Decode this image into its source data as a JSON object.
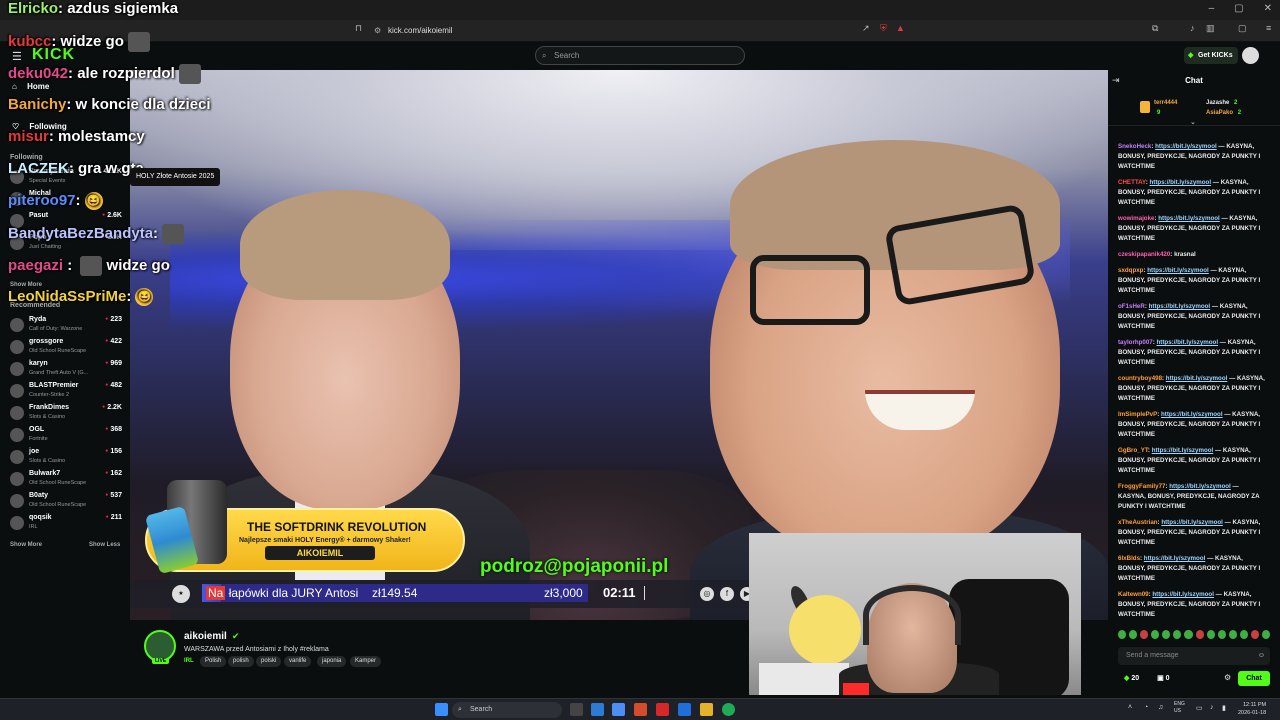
{
  "browser": {
    "url": "kick.com/aikoiemil",
    "window_controls": [
      "–",
      "▢",
      "✕"
    ]
  },
  "header": {
    "logo": "KICK",
    "search_placeholder": "Search",
    "get_kicks_label": "Get KICKs"
  },
  "sidebar": {
    "nav": [
      {
        "label": "Home",
        "icon": "home-icon"
      },
      {
        "label": "Following",
        "icon": "heart-icon"
      }
    ],
    "following_header": "Following",
    "following": [
      {
        "name": "Przemyślenia",
        "game": "Special Events",
        "viewers": "42.1K"
      },
      {
        "name": "Michal",
        "game": "",
        "viewers": ""
      },
      {
        "name": "Pasut",
        "game": "",
        "viewers": "2.6K"
      },
      {
        "name": "Popo",
        "game": "Just Chatting",
        "viewers": "1.9K"
      }
    ],
    "show_more_following": "Show More",
    "recommended_header": "Recommended",
    "recommended": [
      {
        "name": "Ryda",
        "game": "Call of Duty: Warzone",
        "viewers": "223"
      },
      {
        "name": "grossgore",
        "game": "Old School RuneScape",
        "viewers": "422"
      },
      {
        "name": "karyn",
        "game": "Grand Theft Auto V (G...",
        "viewers": "969"
      },
      {
        "name": "BLASTPremier",
        "game": "Counter-Strike 2",
        "viewers": "482"
      },
      {
        "name": "FrankDimes",
        "game": "Slots & Casino",
        "viewers": "2.2K"
      },
      {
        "name": "OGL",
        "game": "Fortnite",
        "viewers": "368"
      },
      {
        "name": "joe",
        "game": "Slots & Casino",
        "viewers": "156"
      },
      {
        "name": "Bulwark7",
        "game": "Old School RuneScape",
        "viewers": "162"
      },
      {
        "name": "B0aty",
        "game": "Old School RuneScape",
        "viewers": "537"
      },
      {
        "name": "qoqsik",
        "game": "IRL",
        "viewers": "211"
      }
    ],
    "show_more": "Show More",
    "show_less": "Show Less"
  },
  "tooltip": "HOLY Złote Antosie 2025",
  "overlay_chat": [
    {
      "user": "Elricko",
      "color": "#9ef06b",
      "msg": ": azdus sigiemka",
      "extra": ""
    },
    {
      "user": "kubcc",
      "color": "#e23a3a",
      "msg": ": widze go",
      "extra": "avatar"
    },
    {
      "user": "deku042",
      "color": "#e24a8c",
      "msg": ": ale rozpierdol",
      "extra": "avatar"
    },
    {
      "user": "Banichy",
      "color": "#f2a83a",
      "msg": ": w koncie dla dzieci",
      "extra": ""
    },
    {
      "user": "misur",
      "color": "#e23a3a",
      "msg": ": molestamcy",
      "extra": ""
    },
    {
      "user": "LACZEK",
      "color": "#c7f0ff",
      "msg": ": gra w gta",
      "extra": ""
    },
    {
      "user": "piteroo97",
      "color": "#5a8cff",
      "msg": ":",
      "extra": "emoji"
    },
    {
      "user": "BandytaBezBandyta",
      "color": "#b9c4ff",
      "msg": ":",
      "extra": "avatar"
    },
    {
      "user": "paegazi",
      "color": "#e24a8c",
      "msg": ": widze go",
      "extra": "avatar-mid"
    },
    {
      "user": "LeoNidaSsPriMe",
      "color": "#f2d23a",
      "msg": ":",
      "extra": "emoji"
    }
  ],
  "promo": {
    "title": "THE SOFTDRINK REVOLUTION",
    "subtitle": "Najlepsze smaki HOLY Energy® + darmowy Shaker!",
    "code": "AIKOIEMIL"
  },
  "email_overlay": "podroz@pojaponii.pl",
  "goal": {
    "prefix": "Na",
    "label": "łapówki dla JURY Antosi",
    "amount": "zł149.54",
    "target": "zł3,000",
    "progress_fraction": 0.05
  },
  "timer": "02:11",
  "channel": {
    "name": "aikoiemil",
    "live": "LIVE",
    "title": "WARSZAWA przed Antosiami z Iholy #reklama",
    "category": "IRL",
    "tags": [
      "Polish",
      "polish",
      "polski",
      "vanlife",
      "japonia",
      "Kamper"
    ]
  },
  "chat": {
    "title": "Chat",
    "leaderboard": [
      {
        "name": "terr4444",
        "count": "9",
        "color": "#f2a83a"
      },
      {
        "name": "Jazashe",
        "count": "2",
        "color": "#fff"
      },
      {
        "name": "AsiaPako",
        "count": "2",
        "color": "#f2a83a"
      }
    ],
    "messages": [
      {
        "user": "SnekoHeck",
        "color": "#c77dff",
        "link": "https://bit.ly/szymool",
        "text": " — KASYNA, BONUSY, PREDYKCJE, NAGRODY ZA PUNKTY I WATCHTIME"
      },
      {
        "user": "CHETTAY",
        "color": "#ff4d4d",
        "link": "https://bit.ly/szymool",
        "text": " — KASYNA, BONUSY, PREDYKCJE, NAGRODY ZA PUNKTY I WATCHTIME"
      },
      {
        "user": "wowimajoke",
        "color": "#ff5fb0",
        "link": "https://bit.ly/szymool",
        "text": " — KASYNA, BONUSY, PREDYKCJE, NAGRODY ZA PUNKTY I WATCHTIME"
      },
      {
        "user": "czeskipapanik420",
        "color": "#ff5fb0",
        "link": "",
        "text": " krasnal"
      },
      {
        "user": "sxdqpxp",
        "color": "#ff9f3a",
        "link": "https://bit.ly/szymool",
        "text": " — KASYNA, BONUSY, PREDYKCJE, NAGRODY ZA PUNKTY I WATCHTIME"
      },
      {
        "user": "oF1sHeR",
        "color": "#c77dff",
        "link": "https://bit.ly/szymool",
        "text": " — KASYNA, BONUSY, PREDYKCJE, NAGRODY ZA PUNKTY I WATCHTIME"
      },
      {
        "user": "taylorhp007",
        "color": "#c77dff",
        "link": "https://bit.ly/szymool",
        "text": " — KASYNA, BONUSY, PREDYKCJE, NAGRODY ZA PUNKTY I WATCHTIME"
      },
      {
        "user": "countryboy498",
        "color": "#ff9f3a",
        "link": "https://bit.ly/szymool",
        "text": " — KASYNA, BONUSY, PREDYKCJE, NAGRODY ZA PUNKTY I WATCHTIME"
      },
      {
        "user": "ImSimplePvP",
        "color": "#ff9f3a",
        "link": "https://bit.ly/szymool",
        "text": " — KASYNA, BONUSY, PREDYKCJE, NAGRODY ZA PUNKTY I WATCHTIME"
      },
      {
        "user": "GgBro_YT",
        "color": "#ff9f3a",
        "link": "https://bit.ly/szymool",
        "text": " — KASYNA, BONUSY, PREDYKCJE, NAGRODY ZA PUNKTY I WATCHTIME"
      },
      {
        "user": "FroggyFamily77",
        "color": "#ff9f3a",
        "link": "https://bit.ly/szymool",
        "text": " — KASYNA, BONUSY, PREDYKCJE, NAGRODY ZA PUNKTY I WATCHTIME"
      },
      {
        "user": "xTheAustrian",
        "color": "#ff9f3a",
        "link": "https://bit.ly/szymool",
        "text": " — KASYNA, BONUSY, PREDYKCJE, NAGRODY ZA PUNKTY I WATCHTIME"
      },
      {
        "user": "6lxBlds",
        "color": "#ff9f3a",
        "link": "https://bit.ly/szymool",
        "text": " — KASYNA, BONUSY, PREDYKCJE, NAGRODY ZA PUNKTY I WATCHTIME"
      },
      {
        "user": "Kaltewn09",
        "color": "#ff9f3a",
        "link": "https://bit.ly/szymool",
        "text": " — KASYNA, BONUSY, PREDYKCJE, NAGRODY ZA PUNKTY I WATCHTIME"
      }
    ],
    "input_placeholder": "Send a message",
    "kicks_count": "20",
    "zero_count": "0",
    "chat_button": "Chat"
  },
  "taskbar": {
    "search_label": "Search",
    "lang_line1": "ENG",
    "lang_line2": "US",
    "time": "12:11 PM",
    "date": "2026-01-18"
  },
  "accent_color": "#53fc18"
}
